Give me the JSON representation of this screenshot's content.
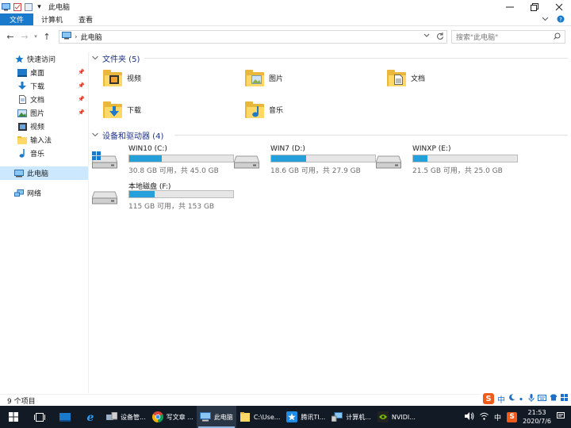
{
  "window": {
    "title": "此电脑",
    "qa_dropdown": "▾"
  },
  "ribbon": {
    "tabs": [
      "文件",
      "计算机",
      "查看"
    ]
  },
  "address": {
    "path": "此电脑",
    "search_placeholder": "搜索\"此电脑\""
  },
  "nav": {
    "quick_access": "快速访问",
    "items": [
      {
        "label": "桌面",
        "icon": "desktop-icon",
        "pinned": true
      },
      {
        "label": "下载",
        "icon": "download-icon",
        "pinned": true
      },
      {
        "label": "文档",
        "icon": "document-icon",
        "pinned": true
      },
      {
        "label": "图片",
        "icon": "picture-icon",
        "pinned": true
      },
      {
        "label": "视频",
        "icon": "video-icon",
        "pinned": false
      },
      {
        "label": "输入法",
        "icon": "folder-icon",
        "pinned": false
      },
      {
        "label": "音乐",
        "icon": "music-icon",
        "pinned": false
      }
    ],
    "this_pc": "此电脑",
    "network": "网络"
  },
  "content": {
    "folders_header": "文件夹 (5)",
    "folders": [
      {
        "label": "视频",
        "icon": "video-folder-icon"
      },
      {
        "label": "图片",
        "icon": "picture-folder-icon"
      },
      {
        "label": "文档",
        "icon": "document-folder-icon"
      },
      {
        "label": "下载",
        "icon": "download-folder-icon"
      },
      {
        "label": "音乐",
        "icon": "music-folder-icon"
      }
    ],
    "drives_header": "设备和驱动器 (4)",
    "drives": [
      {
        "name": "WIN10 (C:)",
        "free": "30.8 GB 可用，共 45.0 GB",
        "used_fraction": 0.316,
        "icon": "windows-drive-icon"
      },
      {
        "name": "WIN7 (D:)",
        "free": "18.6 GB 可用，共 27.9 GB",
        "used_fraction": 0.333,
        "icon": "drive-icon"
      },
      {
        "name": "WINXP (E:)",
        "free": "21.5 GB 可用，共 25.0 GB",
        "used_fraction": 0.14,
        "icon": "drive-icon"
      },
      {
        "name": "本地磁盘 (F:)",
        "free": "115 GB 可用，共 153 GB",
        "used_fraction": 0.248,
        "icon": "drive-icon"
      }
    ]
  },
  "status": {
    "count": "9 个项目"
  },
  "ime": {
    "logo": "S",
    "lang": "中"
  },
  "taskbar": {
    "apps": [
      {
        "label": "设备管...",
        "icon": "device-manager-icon"
      },
      {
        "label": "写文章 ...",
        "icon": "chrome-icon"
      },
      {
        "label": "此电脑",
        "icon": "this-pc-icon",
        "active": true
      },
      {
        "label": "C:\\Use...",
        "icon": "folder-icon"
      },
      {
        "label": "腾讯TI...",
        "icon": "tim-icon"
      },
      {
        "label": "计算机...",
        "icon": "computer-icon"
      },
      {
        "label": "NVIDI...",
        "icon": "nvidia-icon"
      }
    ],
    "tray_lang": "中",
    "time": "21:53",
    "date": "2020/7/6"
  },
  "colors": {
    "accent": "#1979ca",
    "drive_bar": "#26a0da",
    "header_text": "#1e3287",
    "taskbar": "#121a26"
  }
}
